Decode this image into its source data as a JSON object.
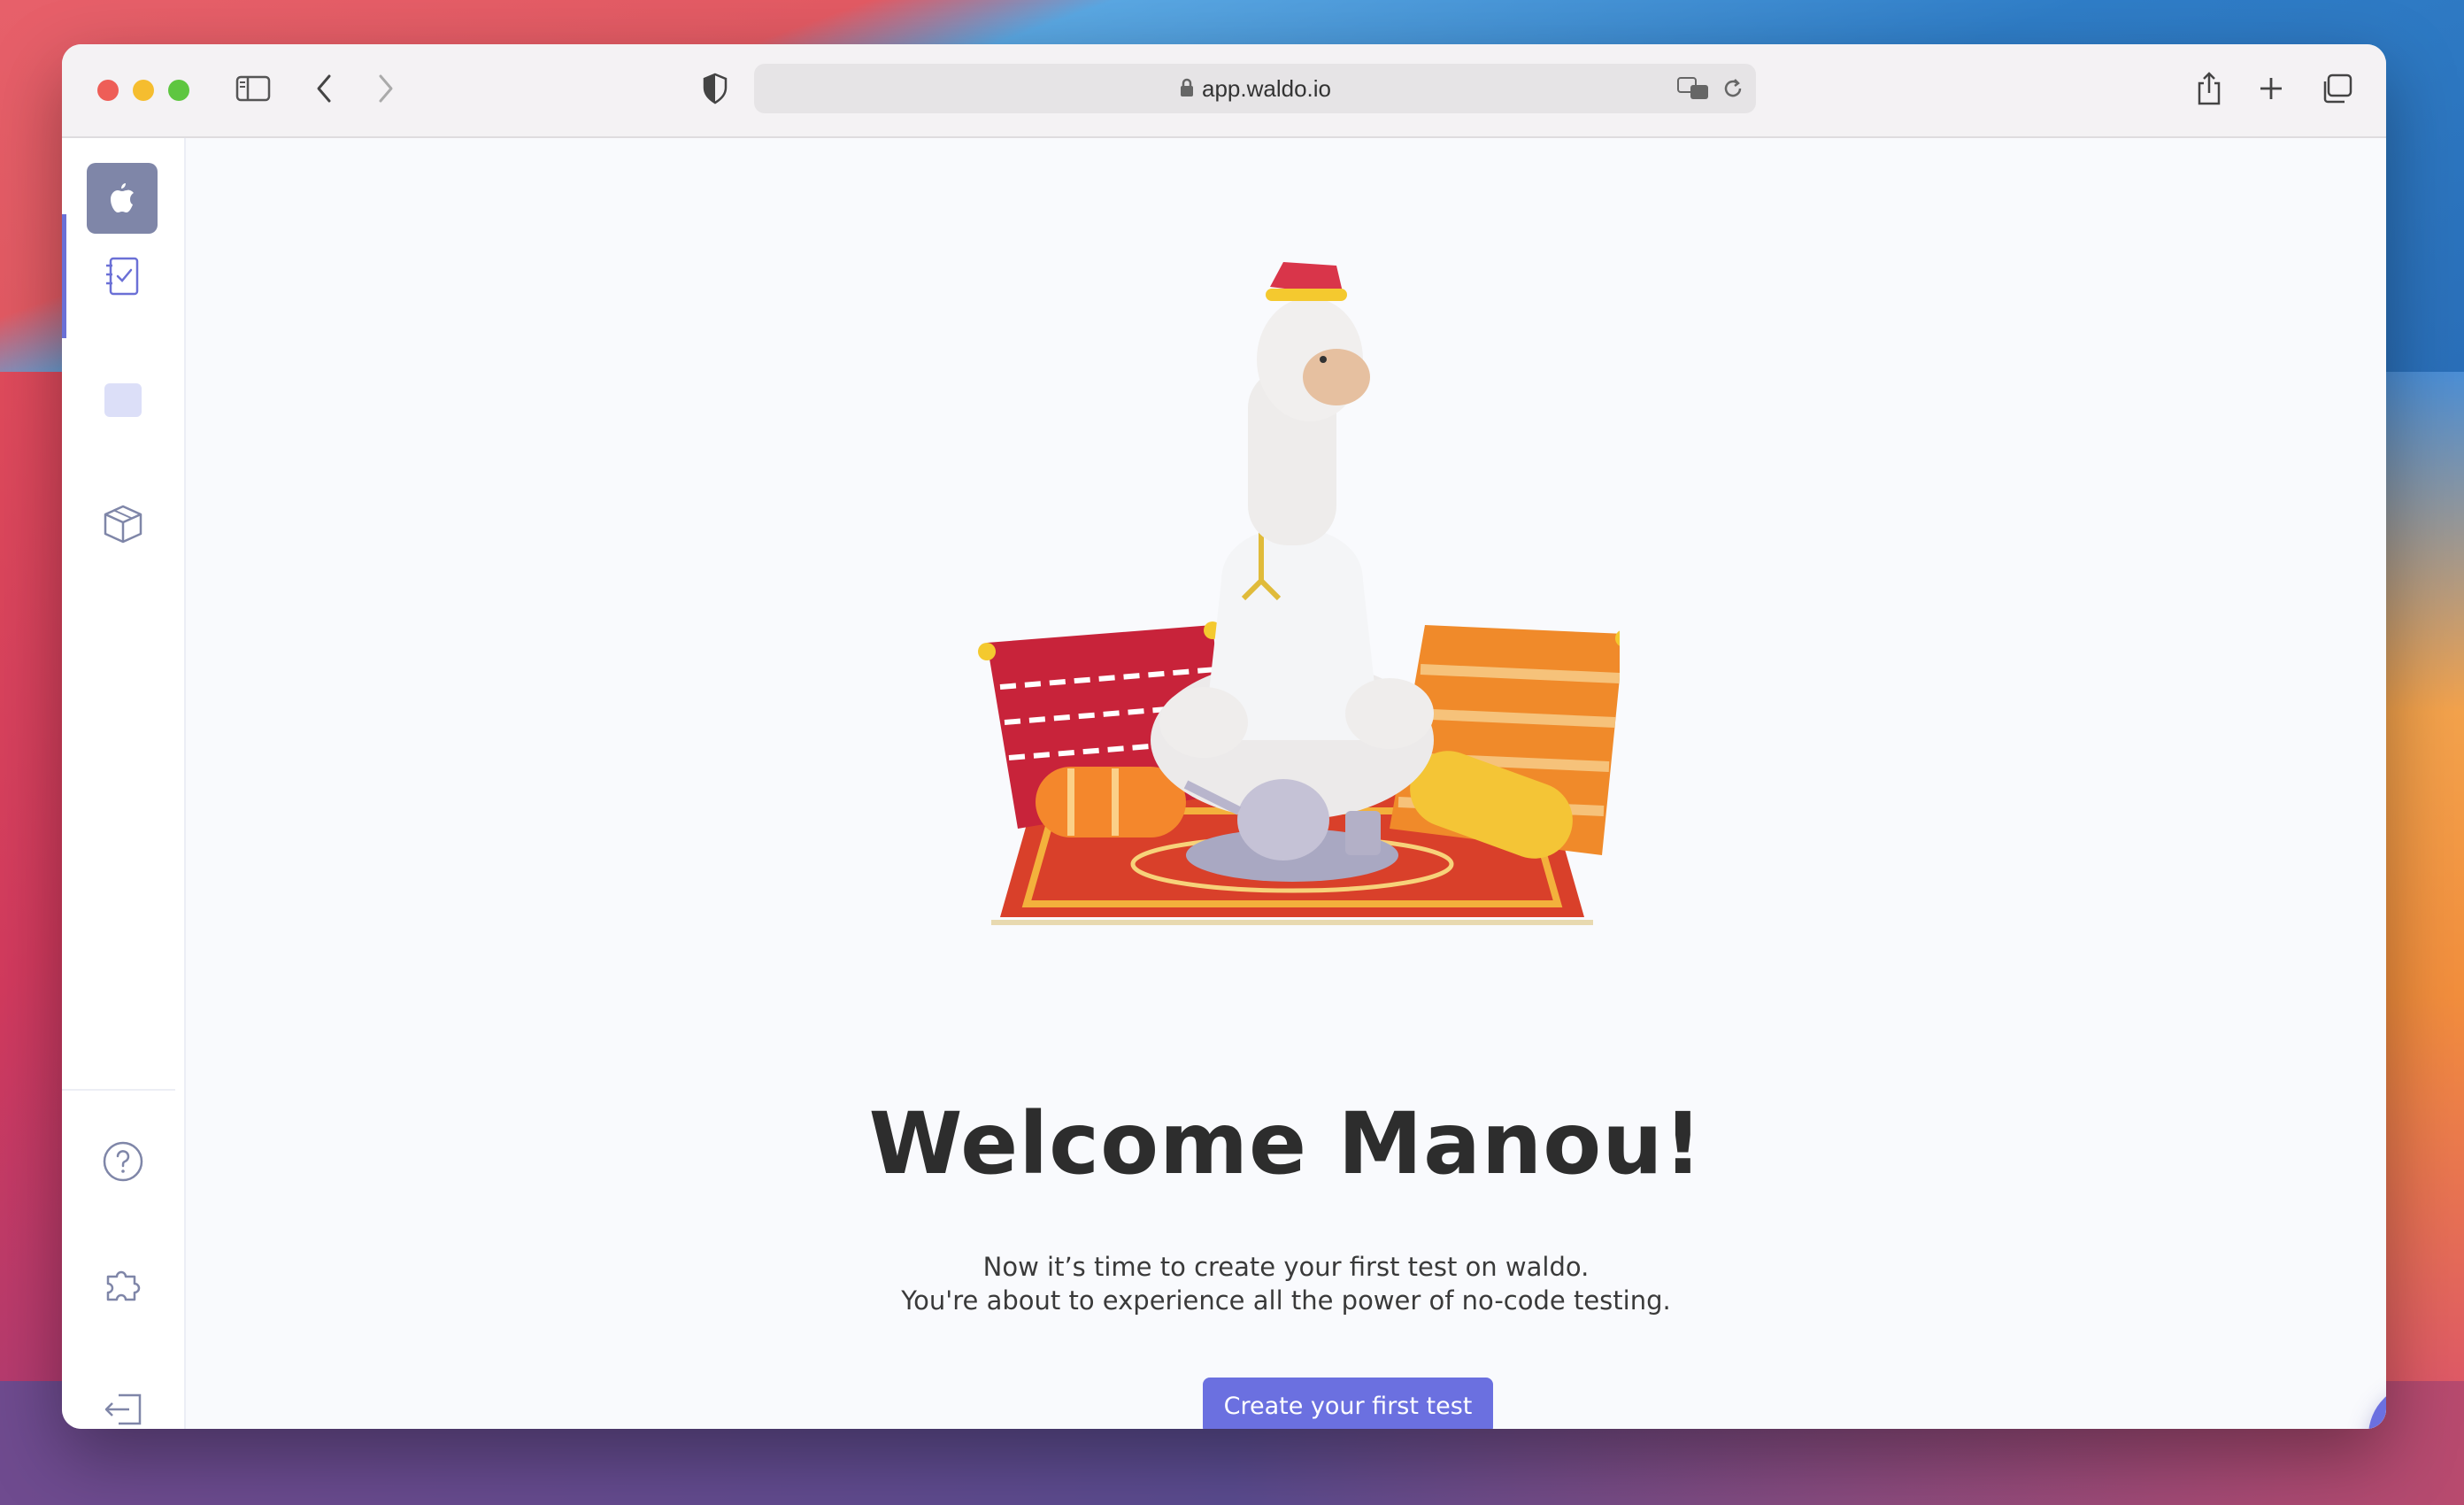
{
  "browser": {
    "url": "app.waldo.io"
  },
  "sidebar": {
    "items": [
      {
        "name": "tests",
        "icon": "checklist-icon",
        "active": true
      },
      {
        "name": "square",
        "icon": "square-icon",
        "active": false
      },
      {
        "name": "builds",
        "icon": "cube-icon",
        "active": false
      }
    ],
    "bottom_items": [
      {
        "name": "help",
        "icon": "help-icon"
      },
      {
        "name": "integrations",
        "icon": "puzzle-icon"
      },
      {
        "name": "logout",
        "icon": "logout-icon"
      }
    ]
  },
  "main": {
    "title": "Welcome Manou!",
    "subtitle_line1": "Now it’s time to create your first test on waldo.",
    "subtitle_line2": "You're about to experience all the power of no-code testing.",
    "cta_label": "Create your first test"
  },
  "colors": {
    "accent": "#6b70e0",
    "sidebar_icon": "#7f86a8",
    "title": "#2d2d2d"
  }
}
